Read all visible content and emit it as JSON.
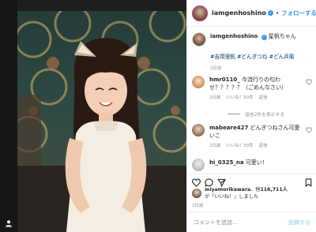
{
  "header": {
    "username": "iamgenhoshino",
    "separator": "•",
    "follow_label": "フォローする"
  },
  "caption": {
    "username": "iamgenhoshino",
    "text": "星帆ちゃん",
    "hashtags": "#吉岡里帆 #どんぎつね #どん兵衛",
    "time": "2日前"
  },
  "comments": [
    {
      "username": "hmr0110_",
      "text": "今流行りの匂わせ？？？？？（ごめんなさい）",
      "time": "2日前",
      "likes": "いいね！50件",
      "reply": "返信"
    },
    {
      "username": "mabeare427",
      "text": "どんぎつねさん可愛いこ",
      "time": "2日前",
      "likes": "いいね！33件",
      "reply": "返信"
    },
    {
      "username": "hi_0325_na",
      "text": "可愛い！"
    }
  ],
  "show_replies": "返信2件を表示する",
  "likes": {
    "username": "miyamorikawara",
    "middle": "、他",
    "count": "116,711人",
    "suffix": "が「いいね！」しました"
  },
  "post_time": "2日前",
  "comment_box": {
    "placeholder": "コメントを追加...",
    "post_label": "投稿する"
  },
  "colors": {
    "link": "#3897f0",
    "hashtag": "#003569",
    "muted": "#8e8e8e"
  },
  "icons": [
    "heart-icon",
    "comment-icon",
    "share-icon",
    "bookmark-icon",
    "verified-icon"
  ]
}
